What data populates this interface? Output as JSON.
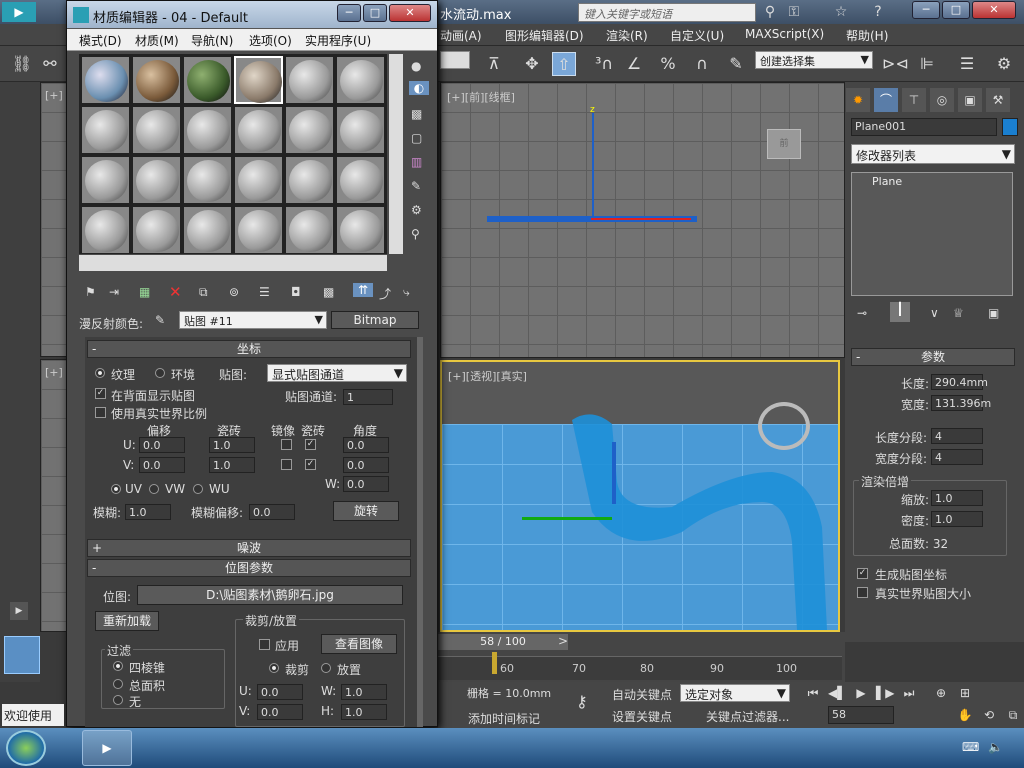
{
  "app": {
    "title": "水流动.max",
    "search_placeholder": "键入关键字或短语"
  },
  "main_menu": [
    "动画(A)",
    "图形编辑器(D)",
    "渲染(R)",
    "自定义(U)",
    "MAXScript(X)",
    "帮助(H)"
  ],
  "toolbar": {
    "selection_set": "创建选择集"
  },
  "viewports": {
    "front_label": "[+][前][线框]",
    "persp_label": "[+][透视][真实]",
    "top_left_label": "[+]",
    "left_label": "[+]"
  },
  "command_panel": {
    "object_name": "Plane001",
    "modifier_list": "修改器列表",
    "stack_item": "Plane",
    "params": {
      "header": "参数",
      "length_label": "长度:",
      "length": "290.4mm",
      "width_label": "宽度:",
      "width": "131.396m",
      "length_segs_label": "长度分段:",
      "length_segs": "4",
      "width_segs_label": "宽度分段:",
      "width_segs": "4",
      "render_mult": "渲染倍增",
      "scale_label": "缩放:",
      "scale": "1.0",
      "density_label": "密度:",
      "density": "1.0",
      "total_faces": "总面数: 32",
      "gen_map_coords": "生成贴图坐标",
      "real_world": "真实世界贴图大小"
    }
  },
  "timeline": {
    "frame": "58 / 100",
    "ticks": [
      "60",
      "70",
      "80",
      "90",
      "100"
    ]
  },
  "bottom": {
    "grid": "栅格 = 10.0mm",
    "add_time_tag": "添加时间标记",
    "auto_key": "自动关键点",
    "set_key": "设置关键点",
    "selected": "选定对象",
    "key_filters": "关键点过滤器...",
    "frame_field": "58",
    "welcome": "欢迎使用"
  },
  "material_editor": {
    "title": "材质编辑器 - 04 - Default",
    "menu": [
      "模式(D)",
      "材质(M)",
      "导航(N)",
      "选项(O)",
      "实用程序(U)"
    ],
    "diffuse_label": "漫反射颜色:",
    "map_name": "贴图 #11",
    "map_type": "Bitmap",
    "coords": {
      "header": "坐标",
      "texture": "纹理",
      "environ": "环境",
      "mapping_label": "贴图:",
      "mapping": "显式贴图通道",
      "show_map_back": "在背面显示贴图",
      "map_channel_label": "贴图通道:",
      "map_channel": "1",
      "real_world": "使用真实世界比例",
      "offset": "偏移",
      "tiling": "瓷砖",
      "mirror": "镜像",
      "tile": "瓷砖",
      "angle": "角度",
      "u_off": "0.0",
      "v_off": "0.0",
      "u_tile": "1.0",
      "v_tile": "1.0",
      "u_ang": "0.0",
      "v_ang": "0.0",
      "w_ang": "0.0",
      "uv": "UV",
      "vw": "VW",
      "wu": "WU",
      "blur_label": "模糊:",
      "blur": "1.0",
      "blur_offset_label": "模糊偏移:",
      "blur_offset": "0.0",
      "rotate": "旋转"
    },
    "noise": "噪波",
    "bitmap_params": "位图参数",
    "bitmap_label": "位图:",
    "bitmap_path": "D:\\贴图素材\\鹅卵石.jpg",
    "reload": "重新加载",
    "crop": {
      "title": "裁剪/放置",
      "apply": "应用",
      "view_image": "查看图像",
      "crop": "裁剪",
      "place": "放置",
      "u": "0.0",
      "v": "0.0",
      "w": "1.0",
      "h": "1.0"
    },
    "filter": {
      "title": "过滤",
      "pyramid": "四棱锥",
      "summed": "总面积",
      "none": "无"
    }
  },
  "colors": {
    "water": "#1e90d8",
    "panel": "#4a4a4a",
    "accent": "#3a8fd8"
  }
}
